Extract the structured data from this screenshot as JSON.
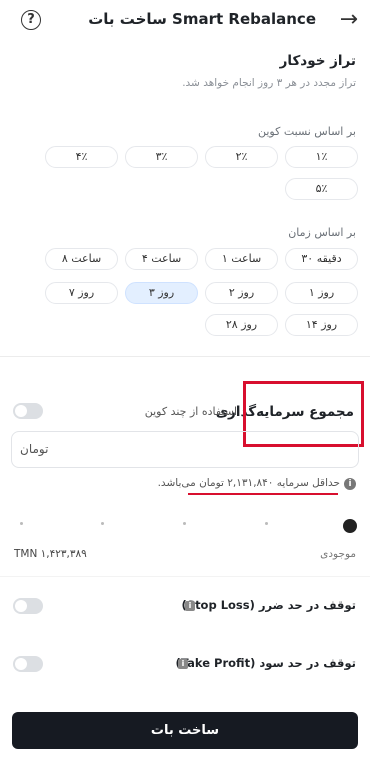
{
  "header": {
    "title": "ساخت بات Smart Rebalance",
    "back_icon": "arrow-right-icon",
    "help_icon": "question-circle-icon"
  },
  "auto_balance": {
    "title": "تراز خودکار",
    "description": "تراز مجدد در هر ۳ روز انجام خواهد شد."
  },
  "coin_ratio": {
    "label": "بر اساس نسبت کوین",
    "options": [
      "۱٪",
      "۲٪",
      "۳٪",
      "۴٪",
      "۵٪"
    ]
  },
  "time_based": {
    "label": "بر اساس زمان",
    "options": [
      "۳۰ دقیقه",
      "۱ ساعت",
      "۴ ساعت",
      "۸ ساعت",
      "۱ روز",
      "۲ روز",
      "۳ روز",
      "۷ روز",
      "۱۴ روز",
      "۲۸ روز"
    ],
    "selected": "۳ روز"
  },
  "investment": {
    "title": "مجموع سرمایه‌گذاری",
    "multi_coin_label": "استفاده از چند کوین",
    "amount_placeholder": "تومان",
    "min_note": "حداقل سرمایه ۲,۱۳۱,۸۴۰ تومان می‌باشد.",
    "balance_label": "موجودی",
    "balance_value": "TMN ۱,۴۲۳,۳۸۹",
    "slider_fraction": 1.0
  },
  "stop_loss": {
    "label": "توقف در حد ضرر (Stop Loss)"
  },
  "take_profit": {
    "label": "توقف در حد سود (Take Profit)"
  },
  "submit": {
    "label": "ساخت بات"
  },
  "colors": {
    "accent_selected": "#e3efff",
    "highlight_red": "#d80f2e",
    "button_dark": "#161a22"
  }
}
